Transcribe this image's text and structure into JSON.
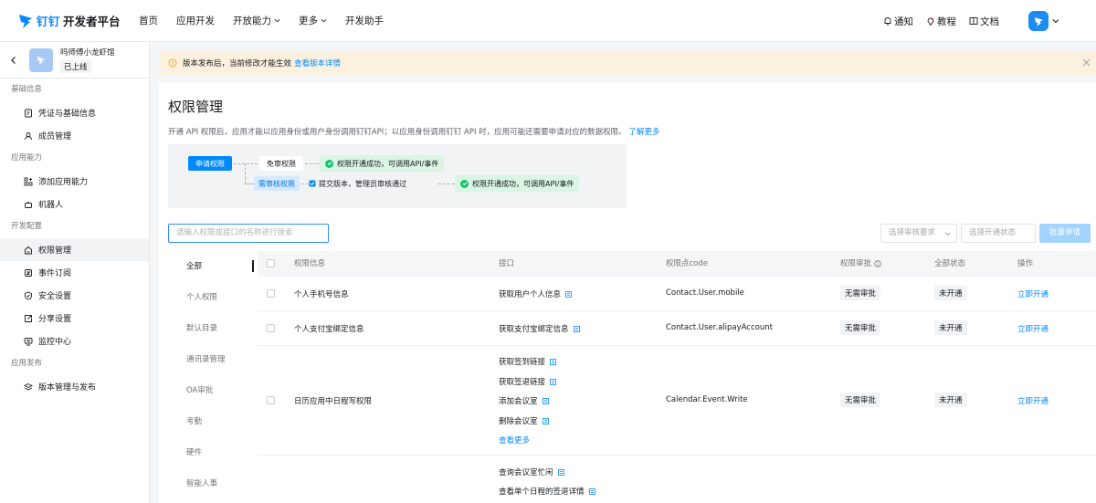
{
  "header": {
    "brand": "钉钉",
    "brand_sub": "开发者平台",
    "nav": [
      "首页",
      "应用开发",
      "开放能力",
      "更多",
      "开发助手"
    ],
    "right": {
      "notify": "通知",
      "tutorial": "教程",
      "docs": "文档"
    }
  },
  "sidebar": {
    "app_name": "吗师傅小龙虾馆",
    "app_status": "已上线",
    "groups": [
      {
        "title": "基础信息",
        "items": [
          "凭证与基础信息",
          "成员管理"
        ]
      },
      {
        "title": "应用能力",
        "items": [
          "添加应用能力",
          "机器人"
        ]
      },
      {
        "title": "开发配置",
        "items": [
          "权限管理",
          "事件订阅",
          "安全设置",
          "分享设置",
          "监控中心"
        ]
      },
      {
        "title": "应用发布",
        "items": [
          "版本管理与发布"
        ]
      }
    ],
    "active_item": "权限管理"
  },
  "notice": {
    "text": "版本发布后，当前修改才能生效",
    "link": "查看版本详情"
  },
  "page": {
    "title": "权限管理",
    "desc": "开通 API 权限后，应用才能以应用身份或用户身份调用钉钉API；以应用身份调用钉钉 API 时，应用可能还需要申请对应的数据权限。",
    "desc_link": "了解更多"
  },
  "flow": {
    "apply": "申请权限",
    "no_review": "免审权限",
    "ok1": "权限开通成功，可调用API/事件",
    "need_review": "需审核权限",
    "submit": "提交版本，管理员审核通过",
    "ok2": "权限开通成功，可调用API/事件"
  },
  "search": {
    "placeholder": "请输入权限或接口的名称进行搜索"
  },
  "filters": {
    "review": "选择审核要求",
    "status": "选择开通状态",
    "bulk": "批量申请"
  },
  "categories": [
    "全部",
    "个人权限",
    "默认目录",
    "通讯录管理",
    "OA审批",
    "考勤",
    "硬件",
    "智能人事"
  ],
  "table": {
    "headers": {
      "name": "权限信息",
      "api": "接口",
      "code": "权限点code",
      "review": "权限审批",
      "status": "全部状态",
      "action": "操作"
    },
    "rows": [
      {
        "name": "个人手机号信息",
        "apis": [
          "获取用户个人信息"
        ],
        "code": "Contact.User.mobile",
        "review": "无需审批",
        "status": "未开通",
        "action": "立即开通"
      },
      {
        "name": "个人支付宝绑定信息",
        "apis": [
          "获取支付宝绑定信息"
        ],
        "code": "Contact.User.alipayAccount",
        "review": "无需审批",
        "status": "未开通",
        "action": "立即开通"
      },
      {
        "name": "日历应用中日程写权限",
        "apis": [
          "获取签到链接",
          "获取签退链接",
          "添加会议室",
          "删除会议室"
        ],
        "more": "查看更多",
        "code": "Calendar.Event.Write",
        "review": "无需审批",
        "status": "未开通",
        "action": "立即开通"
      },
      {
        "apis": [
          "查询会议室忙闲",
          "查看单个日程的签退详情"
        ]
      }
    ]
  },
  "colors": {
    "accent": "#0089ff",
    "notice_bg": "#fbf1de",
    "success": "#16c26b"
  }
}
